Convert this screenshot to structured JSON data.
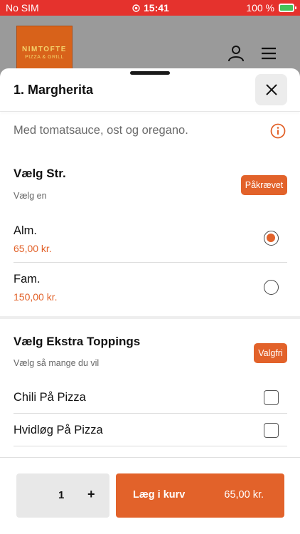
{
  "status_bar": {
    "carrier": "No SIM",
    "time": "15:41",
    "battery": "100 %"
  },
  "header": {
    "logo_line1": "NIMTOFTE",
    "logo_line2": "PIZZA & GRILL"
  },
  "sheet": {
    "title": "1. Margherita",
    "description": "Med tomatsauce, ost og oregano."
  },
  "size_section": {
    "title": "Vælg Str.",
    "subtitle": "Vælg en",
    "badge": "Påkrævet",
    "options": [
      {
        "label": "Alm.",
        "price": "65,00 kr.",
        "selected": true
      },
      {
        "label": "Fam.",
        "price": "150,00 kr.",
        "selected": false
      }
    ]
  },
  "toppings_section": {
    "title": "Vælg Ekstra Toppings",
    "subtitle": "Vælg så mange du vil",
    "badge": "Valgfri",
    "options": [
      {
        "label": "Chili På Pizza",
        "checked": false
      },
      {
        "label": "Hvidløg På Pizza",
        "checked": false
      }
    ]
  },
  "footer": {
    "quantity": "1",
    "plus": "+",
    "add_to_cart": "Læg i kurv",
    "total": "65,00 kr."
  },
  "colors": {
    "accent": "#e2622a",
    "statusbar": "#e5322d"
  }
}
